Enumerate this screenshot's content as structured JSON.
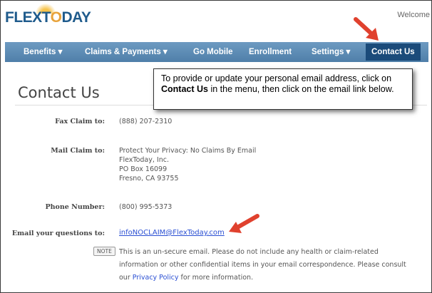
{
  "header": {
    "logo_text_a": "FLEXT",
    "logo_text_o": "O",
    "logo_text_b": "DAY",
    "welcome": "Welcome"
  },
  "nav": {
    "items": [
      {
        "label": "Benefits ▾"
      },
      {
        "label": "Claims & Payments ▾"
      },
      {
        "label": "Go Mobile"
      },
      {
        "label": "Enrollment"
      },
      {
        "label": "Settings ▾"
      },
      {
        "label": "Contact Us"
      }
    ]
  },
  "callout": {
    "line1": "To provide or update your personal email address, click on",
    "bold": "Contact Us",
    "line2": " in the menu, then click on the email link below."
  },
  "page": {
    "title": "Contact Us"
  },
  "contact": {
    "fax_label": "Fax Claim to:",
    "fax_value": "(888) 207-2310",
    "mail_label": "Mail Claim to:",
    "mail_lines": [
      "Protect Your Privacy: No Claims By Email",
      "FlexToday, Inc.",
      "PO Box 16099",
      "Fresno, CA 93755"
    ],
    "phone_label": "Phone Number:",
    "phone_value": "(800) 995-5373",
    "email_label": "Email your questions to:",
    "email_value": "infoNOCLAIM@FlexToday.com"
  },
  "note": {
    "tag": "NOTE",
    "text_before": "This is an un-secure email. Please do not include any health or claim-related information or other confidential items in your email correspondence. Please consult our ",
    "link": "Privacy Policy",
    "text_after": " for more information."
  },
  "colors": {
    "nav_bg": "#5a88b2",
    "nav_active": "#1b4b7a",
    "arrow": "#e0412e",
    "link": "#2a4fd3"
  }
}
